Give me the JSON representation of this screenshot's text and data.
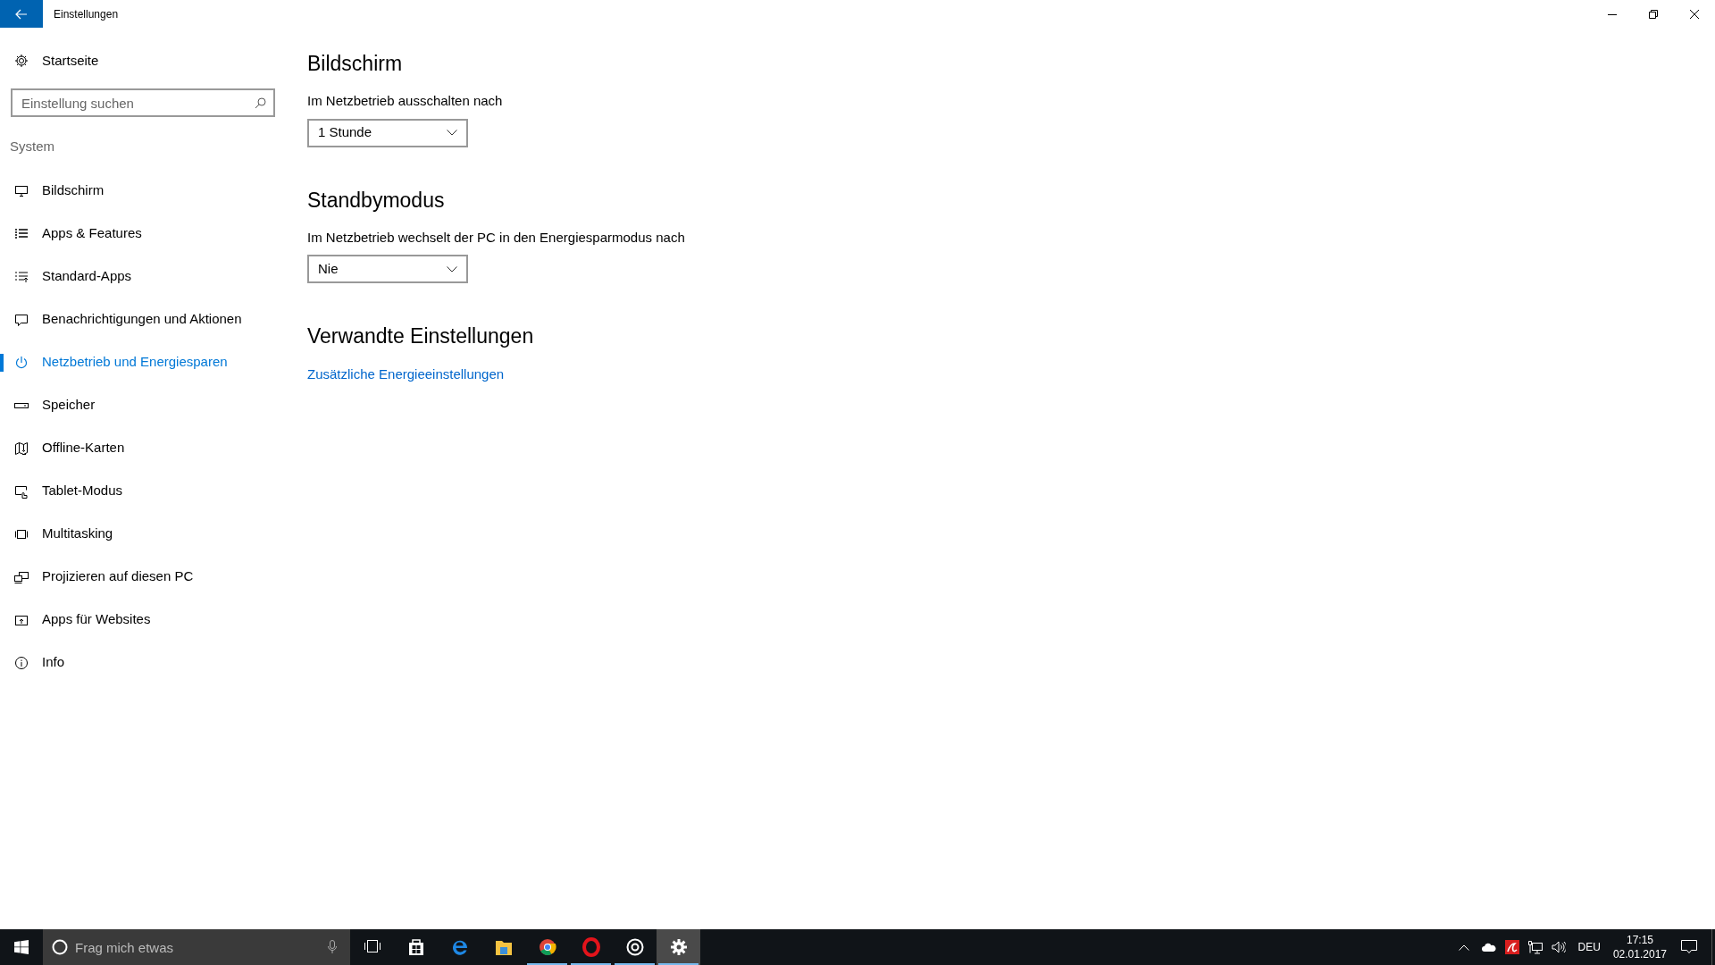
{
  "window": {
    "title": "Einstellungen"
  },
  "sidebar": {
    "home": "Startseite",
    "search": {
      "placeholder": "Einstellung suchen"
    },
    "section": "System",
    "items": [
      {
        "label": "Bildschirm",
        "selected": false
      },
      {
        "label": "Apps & Features",
        "selected": false
      },
      {
        "label": "Standard-Apps",
        "selected": false
      },
      {
        "label": "Benachrichtigungen und Aktionen",
        "selected": false
      },
      {
        "label": "Netzbetrieb und Energiesparen",
        "selected": true
      },
      {
        "label": "Speicher",
        "selected": false
      },
      {
        "label": "Offline-Karten",
        "selected": false
      },
      {
        "label": "Tablet-Modus",
        "selected": false
      },
      {
        "label": "Multitasking",
        "selected": false
      },
      {
        "label": "Projizieren auf diesen PC",
        "selected": false
      },
      {
        "label": "Apps für Websites",
        "selected": false
      },
      {
        "label": "Info",
        "selected": false
      }
    ]
  },
  "content": {
    "sections": [
      {
        "heading": "Bildschirm",
        "label": "Im Netzbetrieb ausschalten nach",
        "dropdown": "1 Stunde"
      },
      {
        "heading": "Standbymodus",
        "label": "Im Netzbetrieb wechselt der PC in den Energiesparmodus nach",
        "dropdown": "Nie"
      },
      {
        "heading": "Verwandte Einstellungen",
        "link": "Zusätzliche Energieeinstellungen"
      }
    ]
  },
  "taskbar": {
    "search": {
      "placeholder": "Frag mich etwas"
    },
    "apps": [
      {
        "running": false,
        "selected": false
      },
      {
        "running": false,
        "selected": false
      },
      {
        "running": false,
        "selected": false
      },
      {
        "running": false,
        "selected": false
      },
      {
        "running": true,
        "selected": false
      },
      {
        "running": true,
        "selected": false
      },
      {
        "running": true,
        "selected": false
      },
      {
        "running": true,
        "selected": true
      }
    ],
    "language": "DEU",
    "time": "17:15",
    "date": "02.01.2017"
  }
}
